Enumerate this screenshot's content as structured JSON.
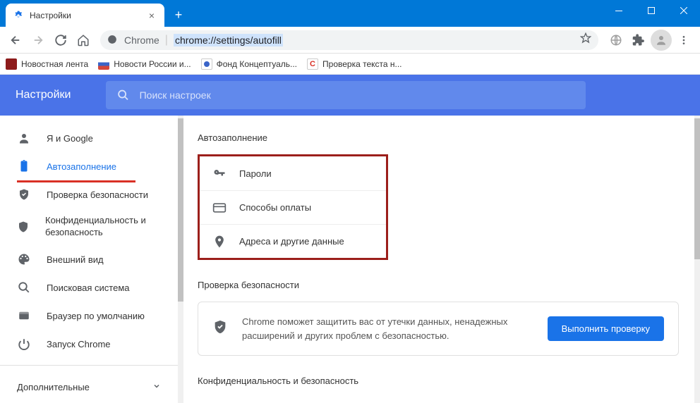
{
  "window": {
    "tab_title": "Настройки"
  },
  "toolbar": {
    "chrome_label": "Chrome",
    "url": "chrome://settings/autofill"
  },
  "bookmarks": [
    {
      "label": "Новостная лента",
      "color": "#8d1b1b"
    },
    {
      "label": "Новости России и...",
      "color": "#d4473b"
    },
    {
      "label": "Фонд Концептуаль...",
      "color": "#3a64c8"
    },
    {
      "label": "Проверка текста н...",
      "color": "#d93025"
    }
  ],
  "settings": {
    "title": "Настройки",
    "search_placeholder": "Поиск настроек"
  },
  "sidebar": {
    "items": [
      {
        "icon": "person",
        "label": "Я и Google"
      },
      {
        "icon": "clipboard",
        "label": "Автозаполнение",
        "active": true
      },
      {
        "icon": "shield-check",
        "label": "Проверка безопасности"
      },
      {
        "icon": "shield",
        "label": "Конфиденциальность и безопасность"
      },
      {
        "icon": "palette",
        "label": "Внешний вид"
      },
      {
        "icon": "search",
        "label": "Поисковая система"
      },
      {
        "icon": "browser",
        "label": "Браузер по умолчанию"
      },
      {
        "icon": "power",
        "label": "Запуск Chrome"
      }
    ],
    "more": "Дополнительные"
  },
  "main": {
    "autofill_title": "Автозаполнение",
    "autofill_rows": [
      {
        "icon": "key",
        "label": "Пароли"
      },
      {
        "icon": "card",
        "label": "Способы оплаты"
      },
      {
        "icon": "pin",
        "label": "Адреса и другие данные"
      }
    ],
    "safety_title": "Проверка безопасности",
    "safety_text": "Chrome поможет защитить вас от утечки данных, ненадежных расширений и других проблем с безопасностью.",
    "safety_button": "Выполнить проверку",
    "privacy_title": "Конфиденциальность и безопасность"
  }
}
